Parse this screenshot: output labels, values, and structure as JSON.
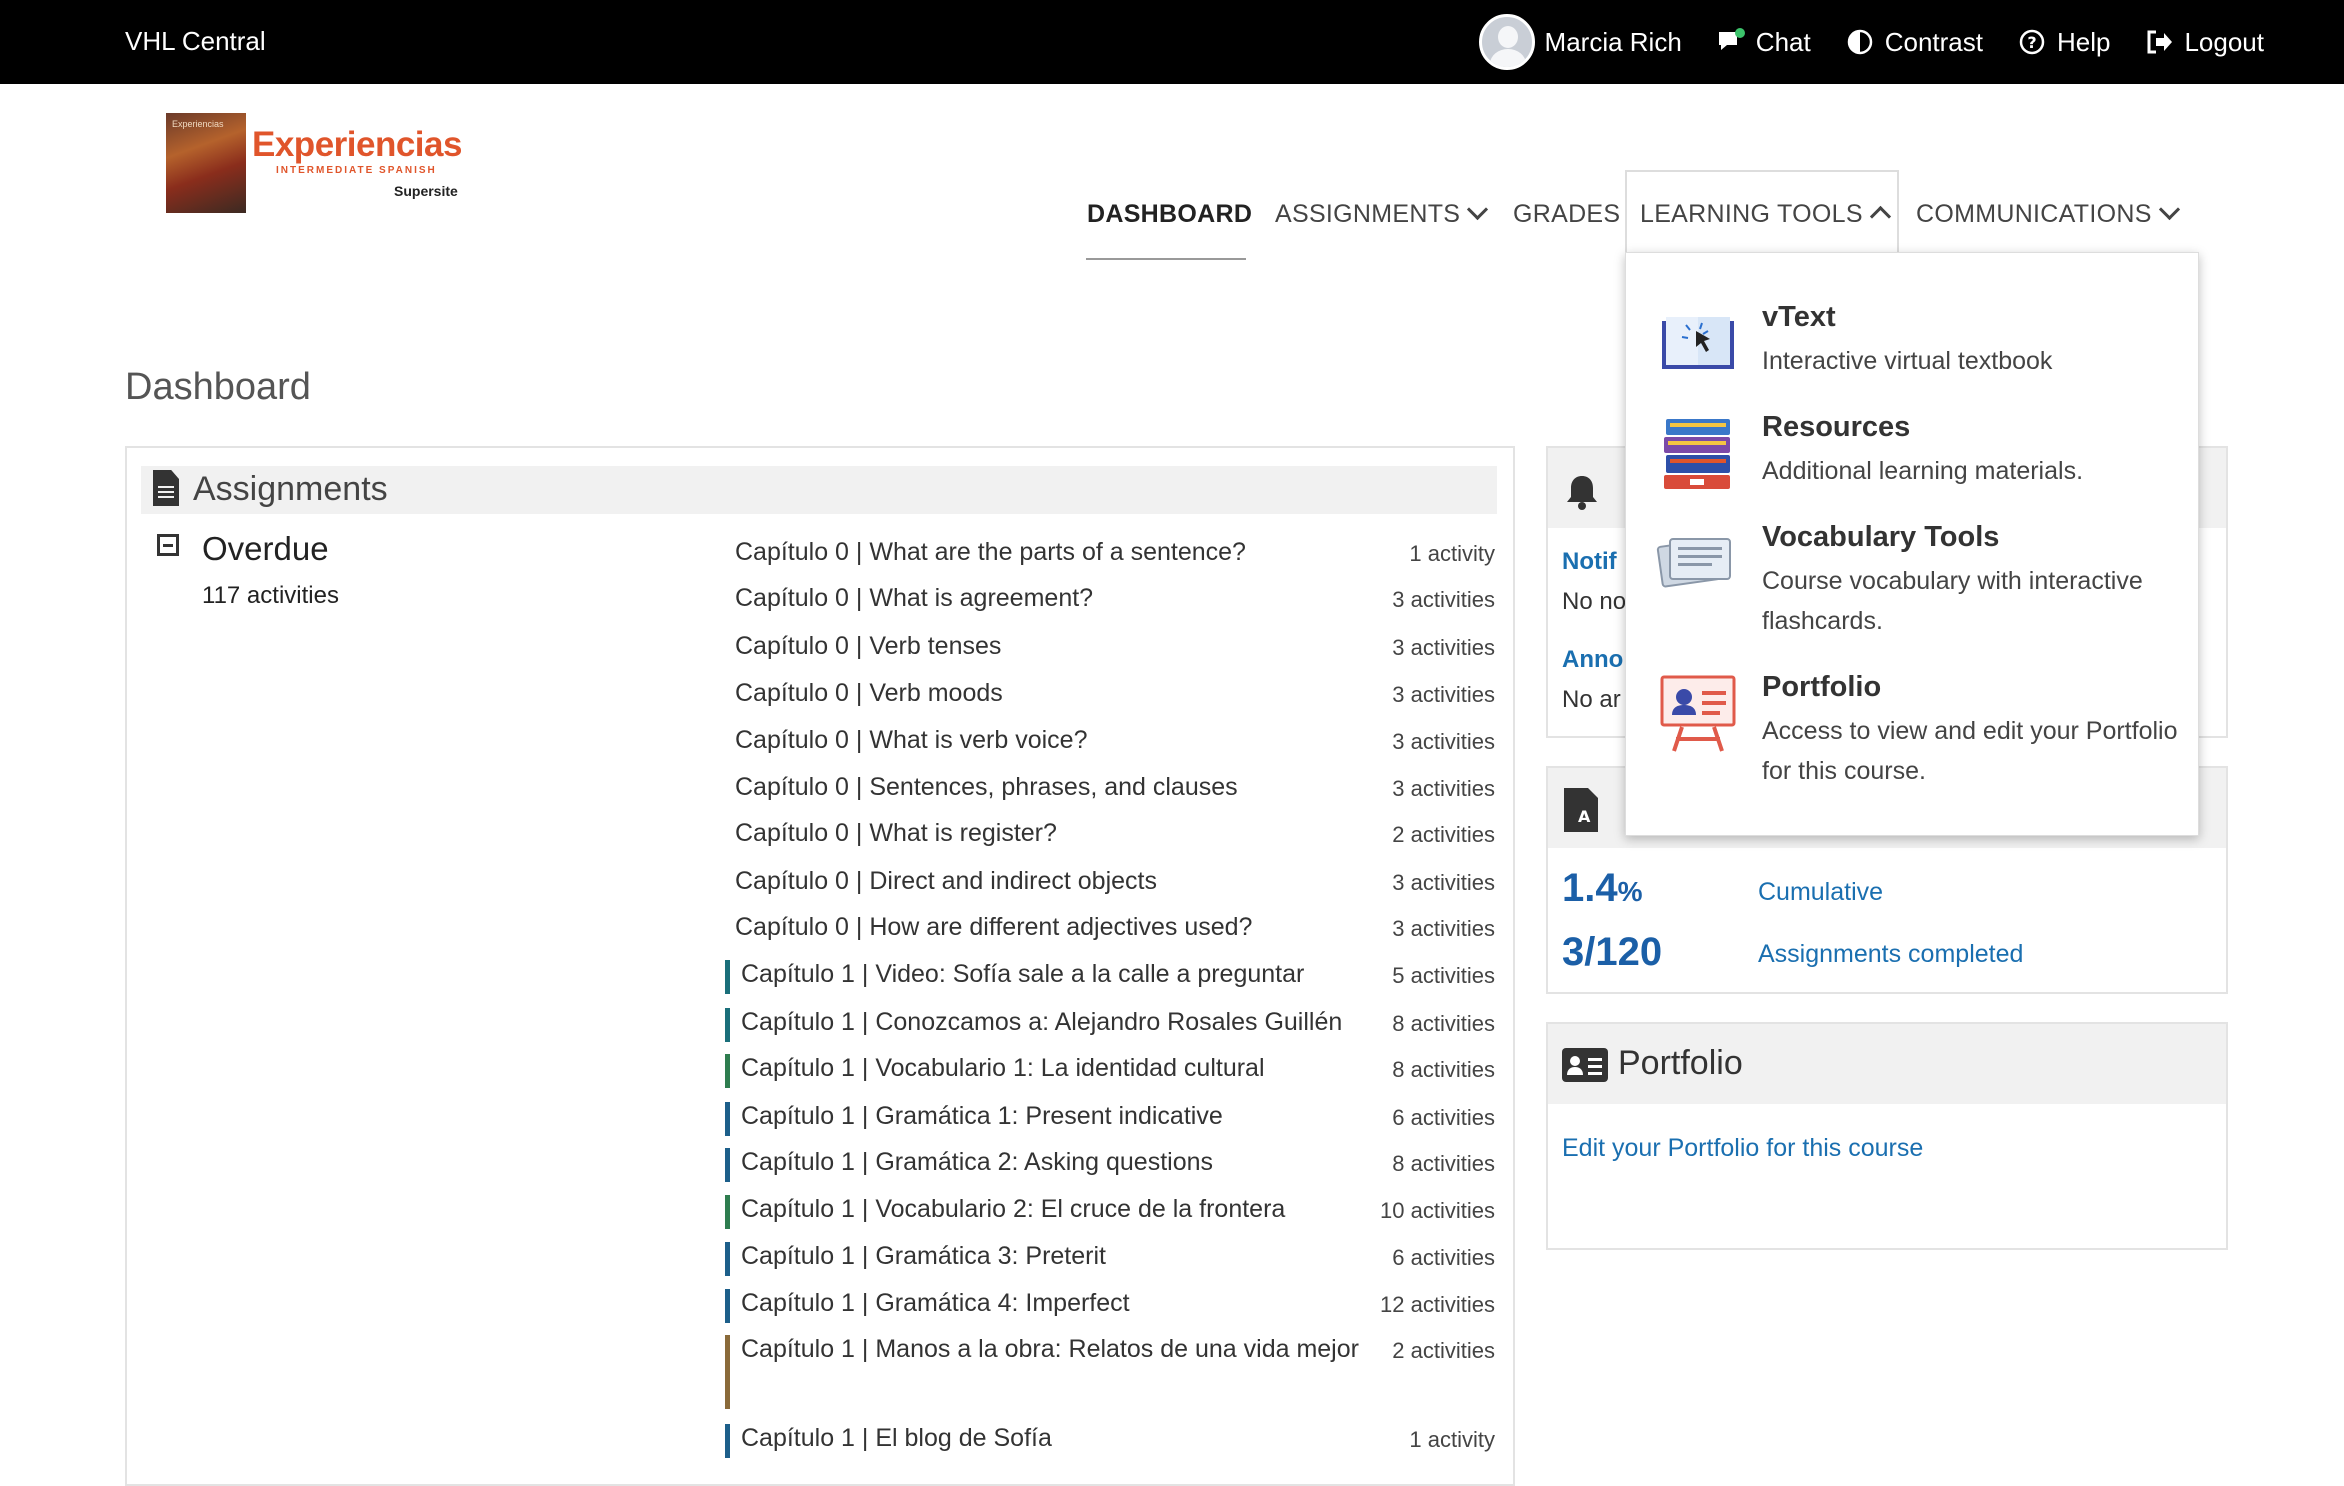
{
  "topbar": {
    "brand": "VHL Central",
    "user": "Marcia Rich",
    "chat": "Chat",
    "contrast": "Contrast",
    "help": "Help",
    "logout": "Logout"
  },
  "logo": {
    "title": "Experiencias",
    "subtitle": "INTERMEDIATE SPANISH",
    "supersite": "Supersite",
    "cover_text": "Experiencias"
  },
  "nav": {
    "dashboard": "DASHBOARD",
    "assignments": "ASSIGNMENTS",
    "grades": "GRADES",
    "learning_tools": "LEARNING TOOLS",
    "communications": "COMMUNICATIONS"
  },
  "page": {
    "title": "Dashboard"
  },
  "assignments": {
    "header": "Assignments",
    "overdue_label": "Overdue",
    "overdue_count": "117 activities",
    "rows": [
      {
        "name": "Capítulo 0 | What are the parts of a sentence?",
        "count": "1 activity",
        "color": ""
      },
      {
        "name": "Capítulo 0 | What is agreement?",
        "count": "3 activities",
        "color": ""
      },
      {
        "name": "Capítulo 0 | Verb tenses",
        "count": "3 activities",
        "color": ""
      },
      {
        "name": "Capítulo 0 | Verb moods",
        "count": "3 activities",
        "color": ""
      },
      {
        "name": "Capítulo 0 | What is verb voice?",
        "count": "3 activities",
        "color": ""
      },
      {
        "name": "Capítulo 0 | Sentences, phrases, and clauses",
        "count": "3 activities",
        "color": ""
      },
      {
        "name": "Capítulo 0 | What is register?",
        "count": "2 activities",
        "color": ""
      },
      {
        "name": "Capítulo 0 | Direct and indirect objects",
        "count": "3 activities",
        "color": ""
      },
      {
        "name": "Capítulo 0 | How are different adjectives used?",
        "count": "3 activities",
        "color": ""
      },
      {
        "name": "Capítulo 1 | Video: Sofía sale a la calle a preguntar",
        "count": "5 activities",
        "color": "#1a6f7a"
      },
      {
        "name": "Capítulo 1 | Conozcamos a: Alejandro Rosales Guillén",
        "count": "8 activities",
        "color": "#1a6f7a"
      },
      {
        "name": "Capítulo 1 | Vocabulario 1: La identidad cultural",
        "count": "8 activities",
        "color": "#2e7d4f"
      },
      {
        "name": "Capítulo 1 | Gramática 1: Present indicative",
        "count": "6 activities",
        "color": "#1d5f8a"
      },
      {
        "name": "Capítulo 1 | Gramática 2: Asking questions",
        "count": "8 activities",
        "color": "#1d5f8a"
      },
      {
        "name": "Capítulo 1 | Vocabulario 2: El cruce de la frontera",
        "count": "10 activities",
        "color": "#2e7d4f"
      },
      {
        "name": "Capítulo 1 | Gramática 3: Preterit",
        "count": "6 activities",
        "color": "#1d5f8a"
      },
      {
        "name": "Capítulo 1 | Gramática 4: Imperfect",
        "count": "12 activities",
        "color": "#1d5f8a"
      },
      {
        "name": "Capítulo 1 | Manos a la obra: Relatos de una vida mejor",
        "count": "2 activities",
        "color": "#8a6a3a"
      },
      {
        "name": "Capítulo 1 | El blog de Sofía",
        "count": "1 activity",
        "color": "#1d5f8a"
      }
    ]
  },
  "communications_panel": {
    "notifications_label": "Notif",
    "notifications_text": "No no",
    "announcements_label": "Anno",
    "announcements_text": "No ar"
  },
  "grades_panel": {
    "percent": "1.4",
    "percent_sign": "%",
    "cumulative": "Cumulative",
    "completed": "3/120",
    "completed_label": "Assignments completed"
  },
  "portfolio_panel": {
    "title": "Portfolio",
    "link": "Edit your Portfolio for this course"
  },
  "learning_tools_menu": [
    {
      "title": "vText",
      "desc": "Interactive virtual textbook",
      "icon": "book-cursor-icon"
    },
    {
      "title": "Resources",
      "desc": "Additional learning materials.",
      "icon": "book-stack-icon"
    },
    {
      "title": "Vocabulary Tools",
      "desc": "Course vocabulary with interactive flashcards.",
      "icon": "flashcards-icon"
    },
    {
      "title": "Portfolio",
      "desc": "Access to view and edit your Portfolio for this course.",
      "icon": "easel-profile-icon"
    }
  ]
}
